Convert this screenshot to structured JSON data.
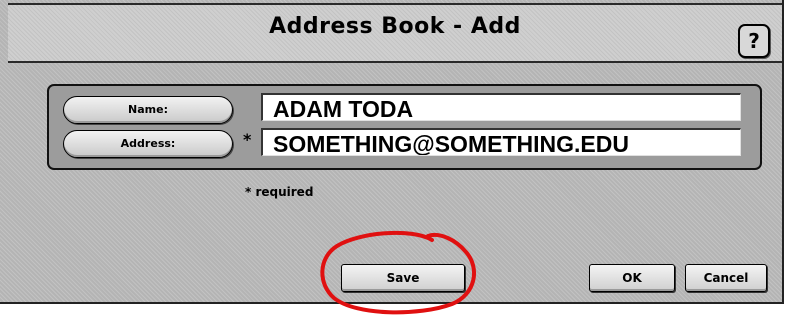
{
  "window": {
    "title": "Address Book - Add",
    "help_label": "?"
  },
  "form": {
    "name_button_label": "Name:",
    "address_button_label": "Address:",
    "required_marker": "*",
    "name_value": "ADAM TODA",
    "address_value": "SOMETHING@SOMETHING.EDU",
    "required_note": "* required"
  },
  "actions": {
    "save_label": "Save",
    "ok_label": "OK",
    "cancel_label": "Cancel"
  },
  "annotation": {
    "color": "#e01010",
    "shape": "circle-around-save-button"
  }
}
